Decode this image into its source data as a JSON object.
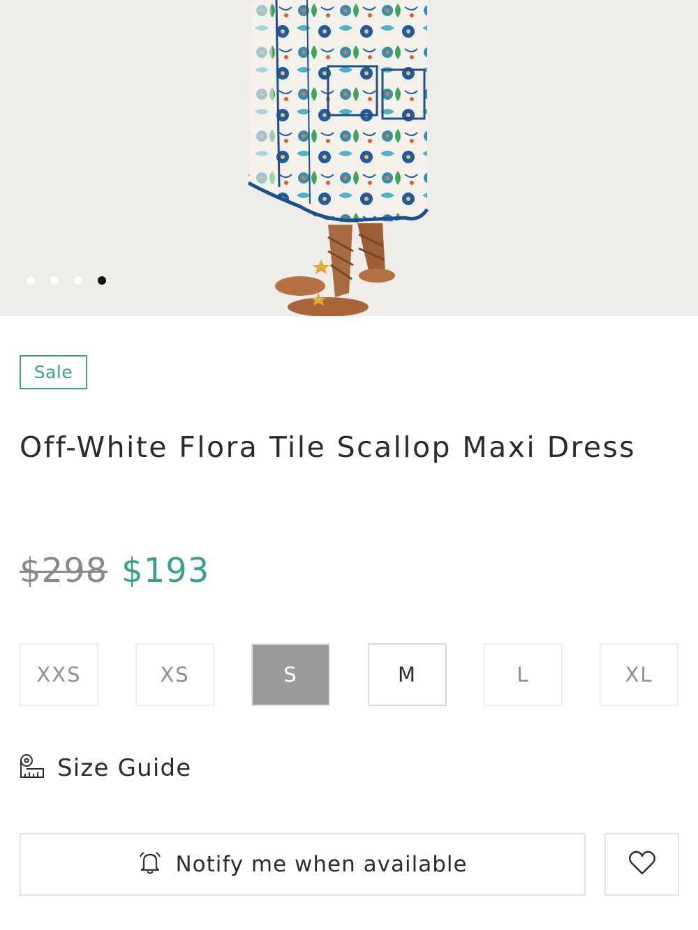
{
  "gallery": {
    "image_alt": "Model wearing floral tile print maxi dress with lace-up sandals",
    "slide_count": 4,
    "active_slide": 4
  },
  "product": {
    "badge": "Sale",
    "title": "Off-White Flora Tile Scallop Maxi Dress",
    "price_original": "$298",
    "price_sale": "$193"
  },
  "sizes": [
    {
      "label": "XXS",
      "state": "unavailable"
    },
    {
      "label": "XS",
      "state": "unavailable"
    },
    {
      "label": "S",
      "state": "selected"
    },
    {
      "label": "M",
      "state": "available"
    },
    {
      "label": "L",
      "state": "unavailable"
    },
    {
      "label": "XL",
      "state": "unavailable"
    }
  ],
  "size_guide": {
    "label": "Size Guide",
    "icon": "measuring-tape-icon"
  },
  "actions": {
    "notify_label": "Notify me when available",
    "notify_icon": "bell-icon",
    "wishlist_icon": "heart-icon"
  },
  "colors": {
    "accent": "#3a9f8c",
    "selected_size_bg": "#9b9b9b",
    "old_price": "#8a8a8a"
  }
}
